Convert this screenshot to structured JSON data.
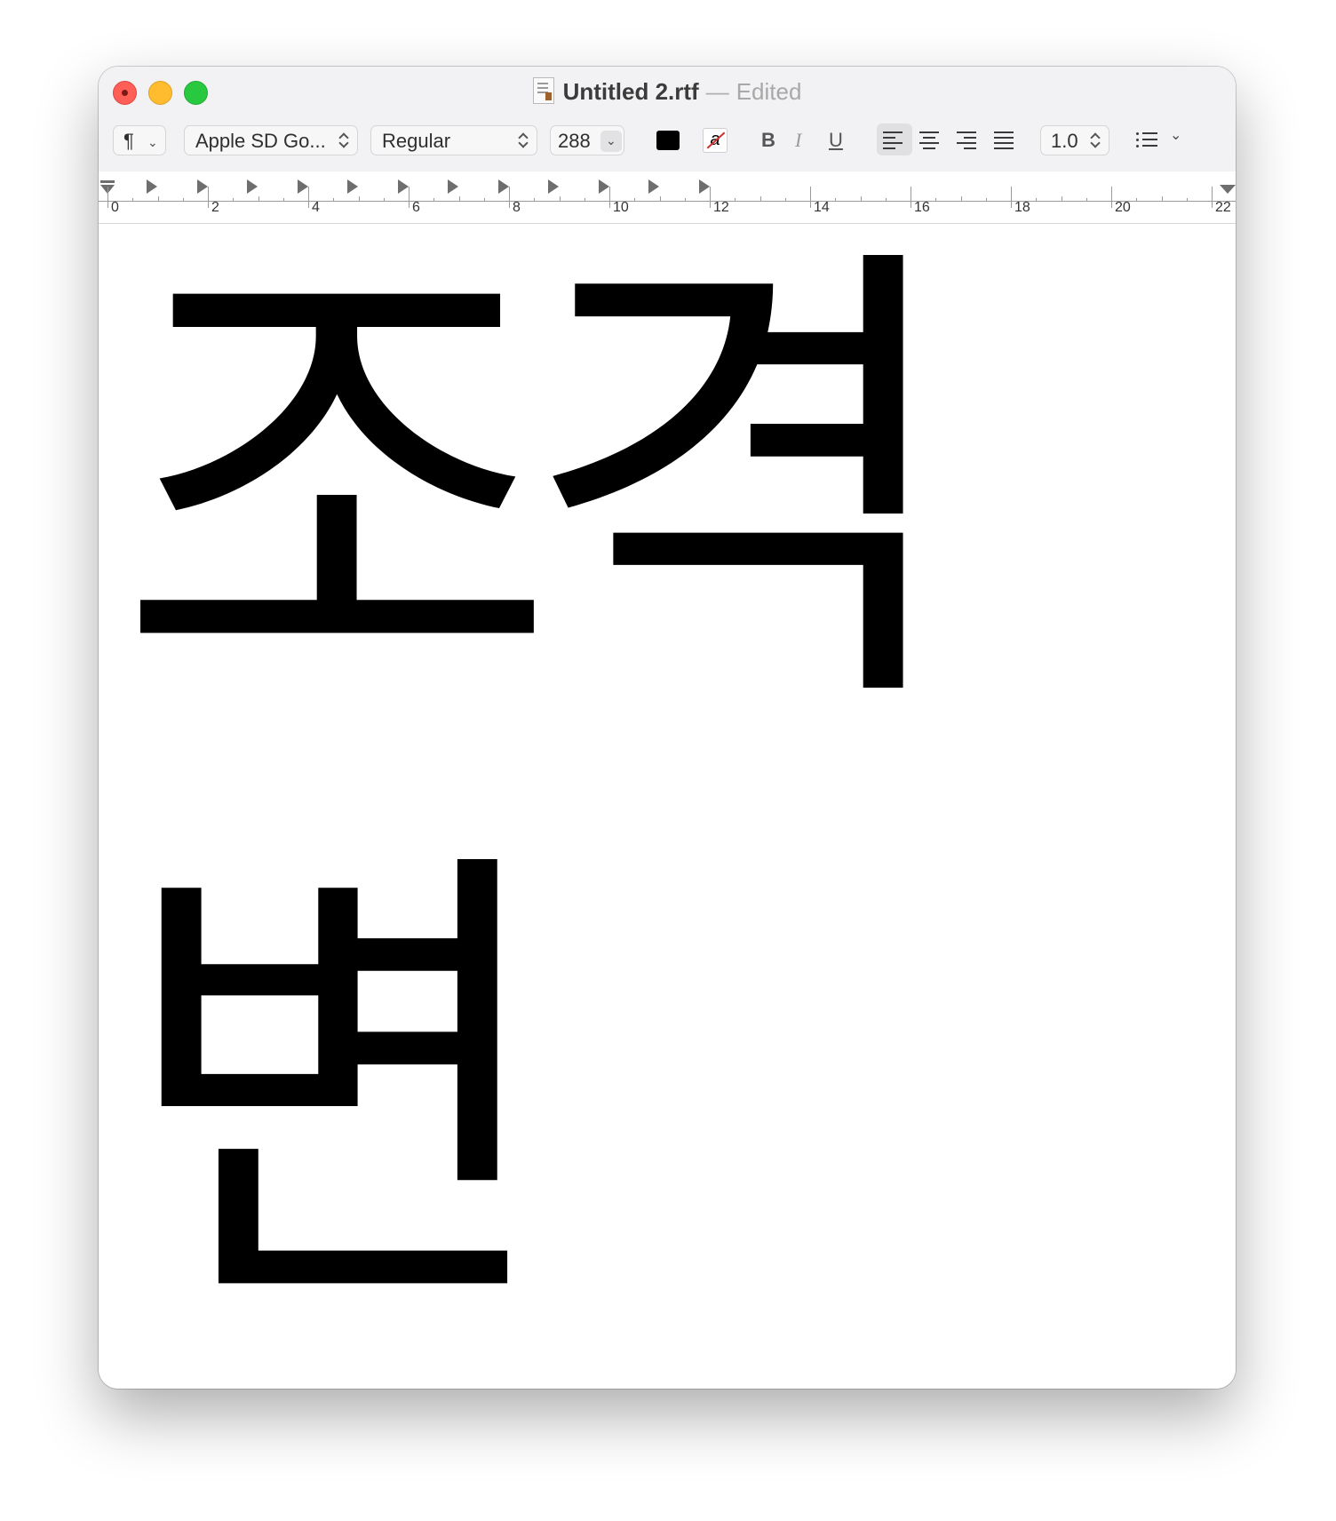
{
  "window": {
    "title": "Untitled 2.rtf",
    "separator": "—",
    "status": "Edited",
    "doc_icon": "rtf-document-icon"
  },
  "toolbar": {
    "paragraph_symbol": "¶",
    "font_family": "Apple SD Go...",
    "font_style": "Regular",
    "font_size": "288",
    "text_color": "#000000",
    "highlight_glyph": "a",
    "bold_label": "B",
    "italic_label": "I",
    "underline_label": "U",
    "line_spacing": "1.0",
    "alignment_selected": "left"
  },
  "ruler": {
    "labels": [
      "0",
      "2",
      "4",
      "6",
      "8",
      "10",
      "12",
      "14",
      "16",
      "18",
      "20",
      "22"
    ]
  },
  "document": {
    "text": "조격변"
  }
}
